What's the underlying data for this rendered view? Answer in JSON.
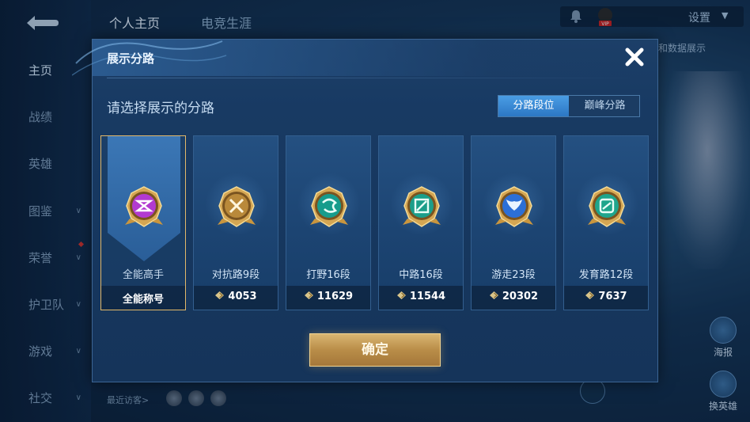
{
  "background": {
    "nav": [
      {
        "label": "主页",
        "active": true,
        "chevron": false
      },
      {
        "label": "战绩",
        "active": false,
        "chevron": false
      },
      {
        "label": "英雄",
        "active": false,
        "chevron": false
      },
      {
        "label": "图鉴",
        "active": false,
        "chevron": true
      },
      {
        "label": "荣誉",
        "active": false,
        "chevron": true
      },
      {
        "label": "护卫队",
        "active": false,
        "chevron": true
      },
      {
        "label": "游戏",
        "active": false,
        "chevron": true
      },
      {
        "label": "社交",
        "active": false,
        "chevron": true
      }
    ],
    "top_tabs": [
      "个人主页",
      "电竞生涯"
    ],
    "settings_label": "设置",
    "vip_label": "VIP",
    "right_peek_text": "和数据展示",
    "side_buttons": [
      "海报",
      "换英雄"
    ],
    "recent_visitors": "最近访客>"
  },
  "modal": {
    "title": "展示分路",
    "subtitle": "请选择展示的分路",
    "toggle": {
      "active": "分路段位",
      "inactive": "巅峰分路"
    },
    "confirm_label": "确定",
    "colors": {
      "accent_gold": "#e3b869",
      "toggle_active": "#3a8ad6"
    },
    "lanes": [
      {
        "name": "全能高手",
        "score": "全能称号",
        "icon": "all-round-master-emblem",
        "selected": true
      },
      {
        "name": "对抗路9段",
        "score": "4053",
        "icon": "clash-lane-emblem",
        "selected": false
      },
      {
        "name": "打野16段",
        "score": "11629",
        "icon": "jungle-dragon-emblem",
        "selected": false
      },
      {
        "name": "中路16段",
        "score": "11544",
        "icon": "mid-lane-emblem",
        "selected": false
      },
      {
        "name": "游走23段",
        "score": "20302",
        "icon": "roam-wings-emblem",
        "selected": false
      },
      {
        "name": "发育路12段",
        "score": "7637",
        "icon": "farm-lane-emblem",
        "selected": false
      }
    ]
  }
}
